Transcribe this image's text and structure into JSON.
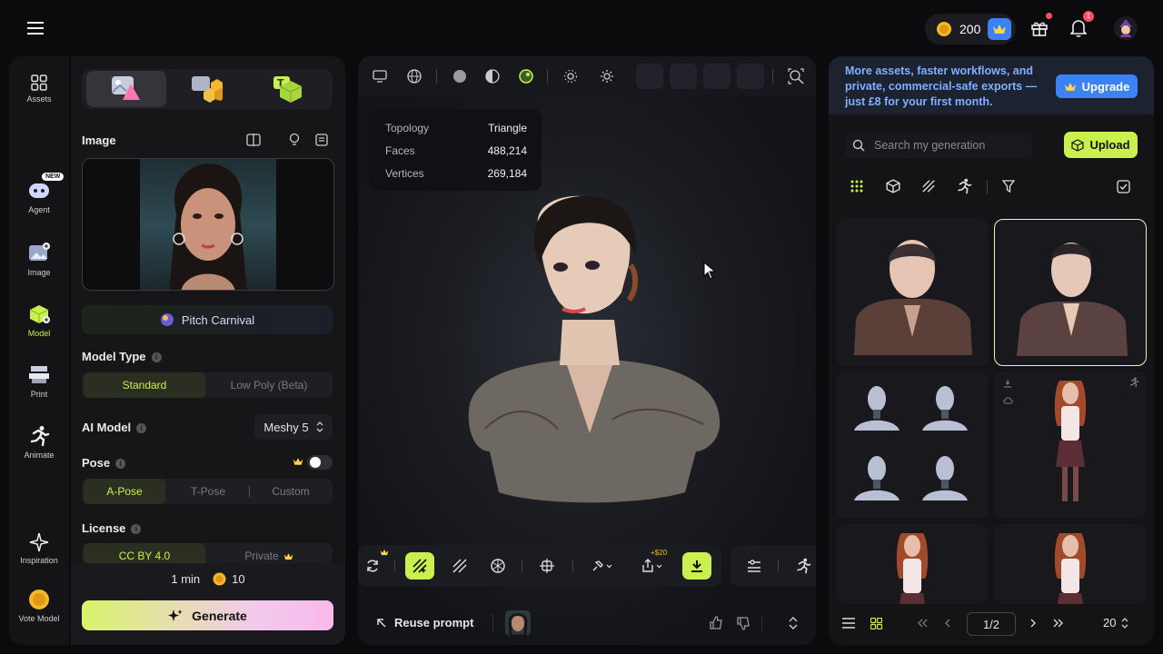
{
  "topbar": {
    "credits": "200",
    "notif_count": "1"
  },
  "rail": [
    {
      "label": "Assets"
    },
    {
      "label": "Agent",
      "badge": "NEW"
    },
    {
      "label": "Image"
    },
    {
      "label": "Model"
    },
    {
      "label": "Print"
    },
    {
      "label": "Animate"
    },
    {
      "label": "Inspiration"
    },
    {
      "label": "Vote Model"
    }
  ],
  "left": {
    "image_title": "Image",
    "style_label": "Pitch Carnival",
    "model_type_title": "Model Type",
    "model_type_options": [
      "Standard",
      "Low Poly (Beta)"
    ],
    "ai_model_title": "AI Model",
    "ai_model_value": "Meshy 5",
    "pose_title": "Pose",
    "pose_options": [
      "A-Pose",
      "T-Pose",
      "Custom"
    ],
    "license_title": "License",
    "license_options": [
      "CC BY 4.0",
      "Private"
    ],
    "time": "1 min",
    "cost": "10",
    "generate_label": "Generate"
  },
  "viewport": {
    "stats": [
      {
        "key": "Topology",
        "value": "Triangle"
      },
      {
        "key": "Faces",
        "value": "488,214"
      },
      {
        "key": "Vertices",
        "value": "269,184"
      }
    ],
    "export_price": "+$20",
    "reuse_prompt": "Reuse prompt"
  },
  "right": {
    "banner_text": "More assets, faster workflows, and private, commercial-safe exports — just £8 for your first month.",
    "upgrade_label": "Upgrade",
    "search_placeholder": "Search my generation",
    "upload_label": "Upload",
    "page": "1/2",
    "per_page": "20"
  },
  "colors": {
    "accent": "#c9f04e",
    "bg": "#0b0b0d",
    "panel": "#161619",
    "upgrade": "#3b82f6",
    "banner_text": "#7fb0ff"
  }
}
